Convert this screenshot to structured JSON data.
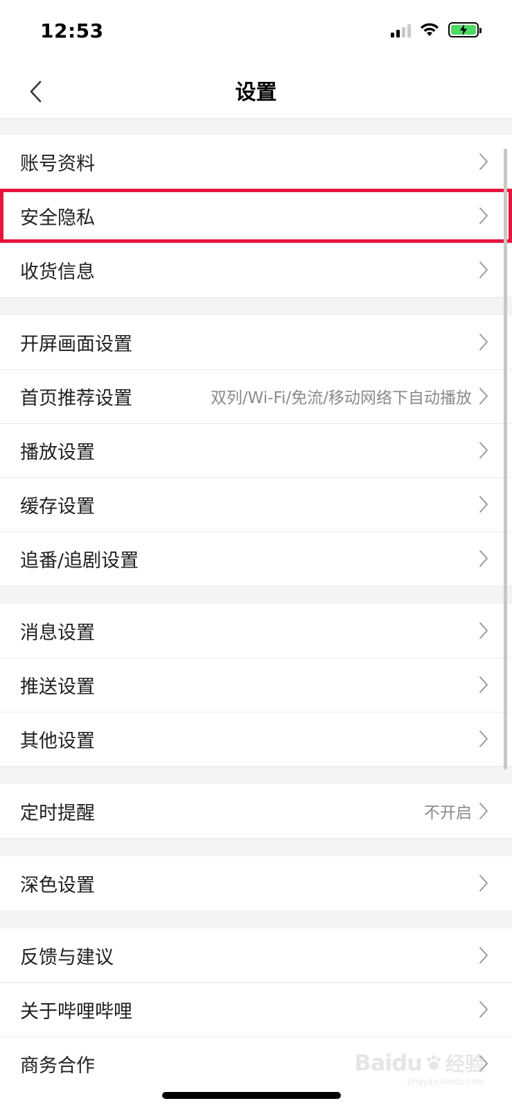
{
  "status_bar": {
    "time": "12:53"
  },
  "nav": {
    "title": "设置"
  },
  "sections": [
    [
      {
        "label": "账号资料",
        "value": "",
        "highlighted": false
      },
      {
        "label": "安全隐私",
        "value": "",
        "highlighted": true
      },
      {
        "label": "收货信息",
        "value": "",
        "highlighted": false
      }
    ],
    [
      {
        "label": "开屏画面设置",
        "value": "",
        "highlighted": false
      },
      {
        "label": "首页推荐设置",
        "value": "双列/Wi-Fi/免流/移动网络下自动播放",
        "highlighted": false
      },
      {
        "label": "播放设置",
        "value": "",
        "highlighted": false
      },
      {
        "label": "缓存设置",
        "value": "",
        "highlighted": false
      },
      {
        "label": "追番/追剧设置",
        "value": "",
        "highlighted": false
      }
    ],
    [
      {
        "label": "消息设置",
        "value": "",
        "highlighted": false
      },
      {
        "label": "推送设置",
        "value": "",
        "highlighted": false
      },
      {
        "label": "其他设置",
        "value": "",
        "highlighted": false
      }
    ],
    [
      {
        "label": "定时提醒",
        "value": "不开启",
        "highlighted": false
      }
    ],
    [
      {
        "label": "深色设置",
        "value": "",
        "highlighted": false
      }
    ],
    [
      {
        "label": "反馈与建议",
        "value": "",
        "highlighted": false
      },
      {
        "label": "关于哔哩哔哩",
        "value": "",
        "highlighted": false
      },
      {
        "label": "商务合作",
        "value": "",
        "highlighted": false
      }
    ]
  ],
  "watermark": {
    "brand": "Baidu",
    "cn": "经验",
    "url": "jingyan.baidu.com"
  },
  "colors": {
    "highlight": "#e8143c",
    "battery": "#4cd964"
  }
}
